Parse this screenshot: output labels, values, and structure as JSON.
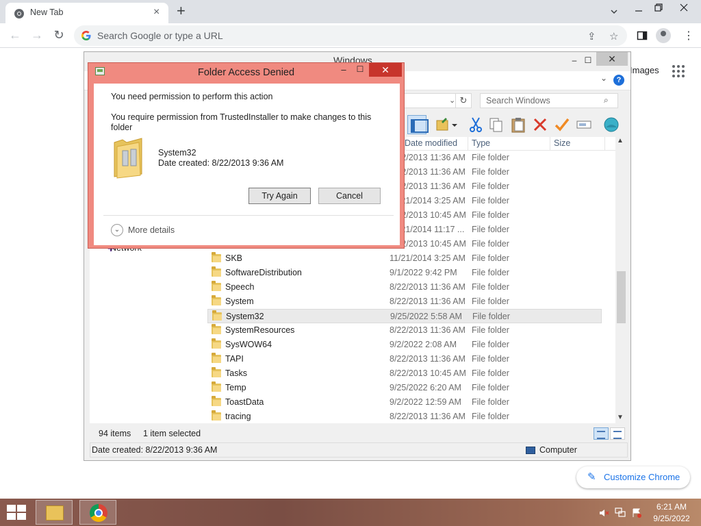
{
  "browser": {
    "tab_title": "New Tab",
    "omnibox_placeholder": "Search Google or type a URL",
    "images_link": "Images",
    "customize_label": "Customize Chrome"
  },
  "explorer": {
    "title": "Windows",
    "search_placeholder": "Search Windows",
    "columns": {
      "date": "Date modified",
      "type": "Type",
      "size": "Size"
    },
    "nav_network": "Network",
    "rows": [
      {
        "name": "",
        "date": "8/22/2013 11:36 AM",
        "type": "File folder"
      },
      {
        "name": "",
        "date": "8/22/2013 11:36 AM",
        "type": "File folder"
      },
      {
        "name": "",
        "date": "8/22/2013 11:36 AM",
        "type": "File folder"
      },
      {
        "name": "",
        "date": "11/21/2014 3:25 AM",
        "type": "File folder"
      },
      {
        "name": "",
        "date": "8/22/2013 10:45 AM",
        "type": "File folder"
      },
      {
        "name": "",
        "date": "11/21/2014 11:17 ...",
        "type": "File folder"
      },
      {
        "name": "",
        "date": "8/22/2013 10:45 AM",
        "type": "File folder"
      },
      {
        "name": "SKB",
        "date": "11/21/2014 3:25 AM",
        "type": "File folder"
      },
      {
        "name": "SoftwareDistribution",
        "date": "9/1/2022 9:42 PM",
        "type": "File folder"
      },
      {
        "name": "Speech",
        "date": "8/22/2013 11:36 AM",
        "type": "File folder"
      },
      {
        "name": "System",
        "date": "8/22/2013 11:36 AM",
        "type": "File folder"
      },
      {
        "name": "System32",
        "date": "9/25/2022 5:58 AM",
        "type": "File folder"
      },
      {
        "name": "SystemResources",
        "date": "8/22/2013 11:36 AM",
        "type": "File folder"
      },
      {
        "name": "SysWOW64",
        "date": "9/2/2022 2:08 AM",
        "type": "File folder"
      },
      {
        "name": "TAPI",
        "date": "8/22/2013 11:36 AM",
        "type": "File folder"
      },
      {
        "name": "Tasks",
        "date": "8/22/2013 10:45 AM",
        "type": "File folder"
      },
      {
        "name": "Temp",
        "date": "9/25/2022 6:20 AM",
        "type": "File folder"
      },
      {
        "name": "ToastData",
        "date": "9/2/2022 12:59 AM",
        "type": "File folder"
      },
      {
        "name": "tracing",
        "date": "8/22/2013 11:36 AM",
        "type": "File folder"
      }
    ],
    "status_items": "94 items",
    "status_selected": "1 item selected",
    "details_date": "Date created: 8/22/2013 9:36 AM",
    "details_location": "Computer"
  },
  "dialog": {
    "title": "Folder Access Denied",
    "message": "You need permission to perform this action",
    "detail": "You require permission from TrustedInstaller to make changes to this folder",
    "folder_name": "System32",
    "folder_date": "Date created: 8/22/2013 9:36 AM",
    "try_again_label": "Try Again",
    "cancel_label": "Cancel",
    "more_details_label": "More details"
  },
  "taskbar": {
    "time": "6:21 AM",
    "date": "9/25/2022"
  },
  "icons": {
    "tab_close": "×",
    "new_tab": "+",
    "back": "←",
    "forward": "→",
    "reload": "↻",
    "share": "⇪",
    "star": "☆",
    "menu": "⋮",
    "pen": "✎",
    "help": "?",
    "search": "⌕",
    "scroll_up": "▲",
    "scroll_down": "▼",
    "chevron_down": "⌄",
    "window_min": "–",
    "window_max": "☐",
    "window_close": "✕"
  }
}
